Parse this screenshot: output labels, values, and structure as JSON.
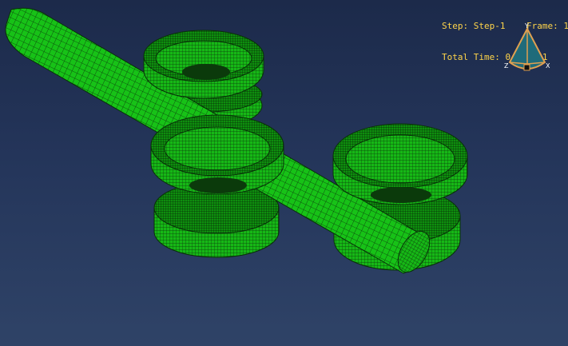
{
  "viewport": {
    "background_top": "#1c2a4a",
    "background_bottom": "#2f4367",
    "mesh_fill": "#17c217",
    "mesh_line": "#0b3a0b"
  },
  "hud": {
    "step_line": "Step: Step-1    Frame: 1",
    "time_line": "Total Time: 0.015001"
  },
  "triad": {
    "y_label": "Y",
    "z_label": "Z",
    "x_label": "X",
    "colors": {
      "fill": "#1f6b7a",
      "edge": "#e0a050"
    }
  }
}
